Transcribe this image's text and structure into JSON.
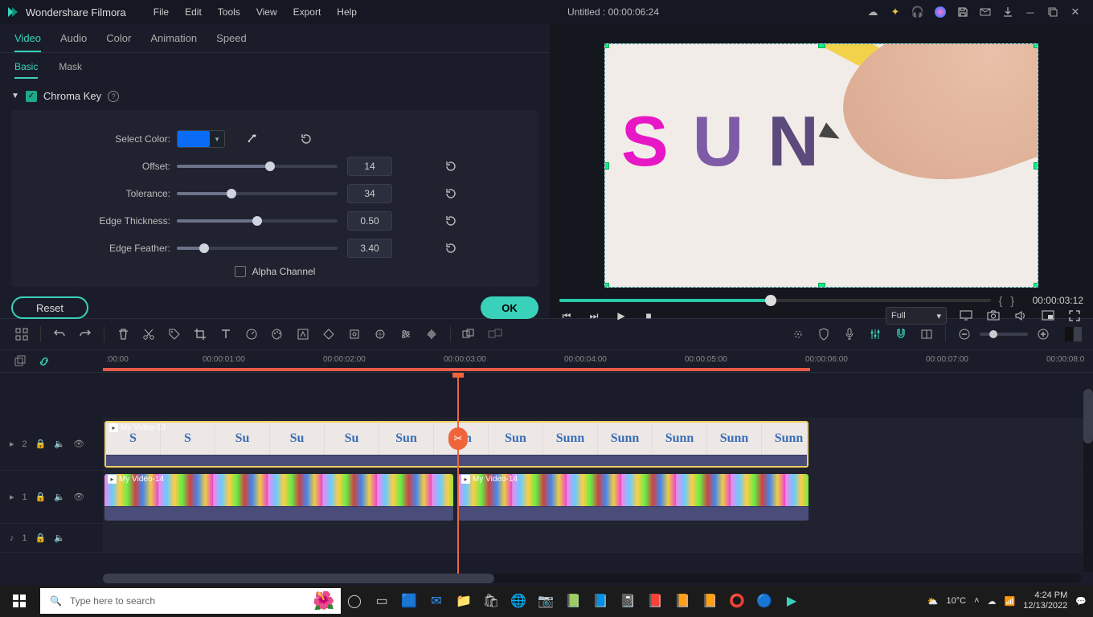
{
  "app": {
    "name": "Wondershare Filmora"
  },
  "menu": {
    "file": "File",
    "edit": "Edit",
    "tools": "Tools",
    "view": "View",
    "export": "Export",
    "help": "Help"
  },
  "title_center": "Untitled : 00:00:06:24",
  "panel_tabs": {
    "video": "Video",
    "audio": "Audio",
    "color": "Color",
    "animation": "Animation",
    "speed": "Speed"
  },
  "subtabs": {
    "basic": "Basic",
    "mask": "Mask"
  },
  "chroma": {
    "title": "Chroma Key",
    "select_color": "Select Color:",
    "color": "#0a6cf5",
    "offset_lbl": "Offset:",
    "offset_val": "14",
    "offset_pct": 58,
    "tolerance_lbl": "Tolerance:",
    "tolerance_val": "34",
    "tolerance_pct": 34,
    "edge_thick_lbl": "Edge Thickness:",
    "edge_thick_val": "0.50",
    "edge_thick_pct": 50,
    "edge_feather_lbl": "Edge Feather:",
    "edge_feather_val": "3.40",
    "edge_feather_pct": 17,
    "alpha": "Alpha Channel"
  },
  "buttons": {
    "reset": "Reset",
    "ok": "OK"
  },
  "preview": {
    "time": "00:00:03:12",
    "fit": "Full",
    "text_s": "S",
    "text_u": "U",
    "text_n": "N"
  },
  "ruler": {
    "t0": ":00:00",
    "t1": "00:00:01:00",
    "t2": "00:00:02:00",
    "t3": "00:00:03:00",
    "t4": "00:00:04:00",
    "t5": "00:00:05:00",
    "t6": "00:00:06:00",
    "t7": "00:00:07:00",
    "t8": "00:00:08:0"
  },
  "tracks": {
    "v2_label": "2",
    "v1_label": "1",
    "a1_label": "1",
    "clip_v2": "My Video-13",
    "clip_v1a": "My Video-14",
    "clip_v1b": "My Video-14",
    "v2_icon": "▸",
    "v1_icon": "▸",
    "a1_icon": "♪"
  },
  "taskbar": {
    "search_placeholder": "Type here to search",
    "weather": "10°C",
    "time": "4:24 PM",
    "date": "12/13/2022"
  }
}
